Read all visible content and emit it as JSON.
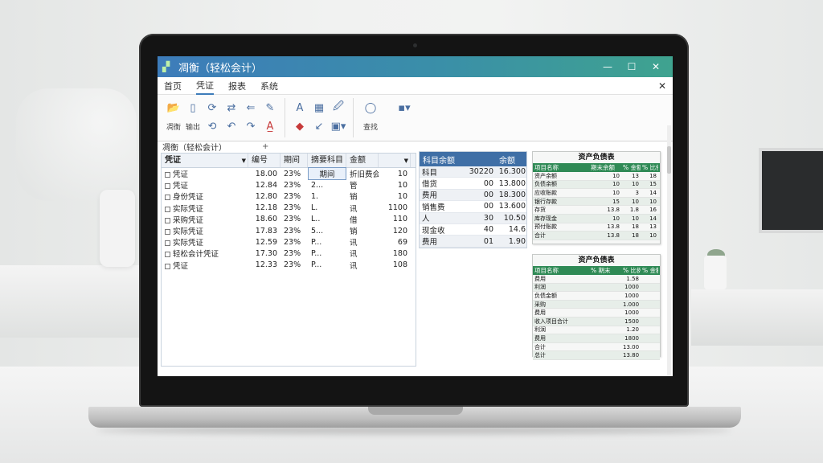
{
  "window": {
    "title": "凋衡（轻松会计）",
    "minimize": "—",
    "maximize": "☐",
    "close": "✕"
  },
  "menu": {
    "items": [
      "首页",
      "凭证",
      "报表",
      "系统"
    ],
    "close": "✕"
  },
  "ribbon": {
    "labels": [
      "凋衡",
      "输出",
      "查找"
    ]
  },
  "sheet": {
    "name": "凋衡（轻松会计）",
    "plus": "+"
  },
  "voucher_table": {
    "headers": [
      "凭证",
      "编号",
      "期间",
      "摘要科目",
      "金额",
      ""
    ],
    "rows": [
      {
        "name": "凭证",
        "date": "18.00",
        "code": "23%",
        "mid": "期间",
        "subj": "折旧费会计",
        "amt": "10"
      },
      {
        "name": "凭证",
        "date": "12.84",
        "code": "23%",
        "mid": "2...",
        "subj": "管",
        "amt": "10"
      },
      {
        "name": "身份凭证",
        "date": "12.80",
        "code": "23%",
        "mid": "1.",
        "subj": "销",
        "amt": "10"
      },
      {
        "name": "实际凭证",
        "date": "12.18",
        "code": "23%",
        "mid": "L.",
        "subj": "讯",
        "amt": "1100"
      },
      {
        "name": "采购凭证",
        "date": "18.60",
        "code": "23%",
        "mid": "L..",
        "subj": "借",
        "amt": "110"
      },
      {
        "name": "实际凭证",
        "date": "17.83",
        "code": "23%",
        "mid": "5...",
        "subj": "销",
        "amt": "120"
      },
      {
        "name": "实际凭证",
        "date": "12.59",
        "code": "23%",
        "mid": "P...",
        "subj": "讯",
        "amt": "69"
      },
      {
        "name": "轻松会计凭证",
        "date": "17.30",
        "code": "23%",
        "mid": "P...",
        "subj": "讯",
        "amt": "180"
      },
      {
        "name": "凭证",
        "date": "12.33",
        "code": "23%",
        "mid": "P...",
        "subj": "讯",
        "amt": "108"
      }
    ]
  },
  "account_table": {
    "headers": [
      "科目余额",
      "余额"
    ],
    "rows": [
      {
        "a": "科目",
        "b": "30220",
        "c": "16.300"
      },
      {
        "a": "借货",
        "b": "00",
        "c": "13.800"
      },
      {
        "a": "费用",
        "b": "00",
        "c": "18.300"
      },
      {
        "a": "销售费",
        "b": "00",
        "c": "13.600"
      },
      {
        "a": "人",
        "b": "30",
        "c": "10.50"
      },
      {
        "a": "现金收",
        "b": "40",
        "c": "14.6"
      },
      {
        "a": "费用",
        "b": "01",
        "c": "1.90"
      }
    ]
  },
  "report1": {
    "title": "资产负债表",
    "headers": [
      "项目名称",
      "期末余额",
      "% 金额",
      "% 比例"
    ],
    "rows": [
      {
        "a": "资产余额",
        "b": "10",
        "c": "13",
        "d": "18"
      },
      {
        "a": "负债余额",
        "b": "10",
        "c": "10",
        "d": "15"
      },
      {
        "a": "应收账款",
        "b": "10",
        "c": "3",
        "d": "14"
      },
      {
        "a": "银行存款",
        "b": "15",
        "c": "10",
        "d": "10"
      },
      {
        "a": "存货",
        "b": "13.8",
        "c": "1.8",
        "d": "16"
      },
      {
        "a": "库存现金",
        "b": "10",
        "c": "10",
        "d": "14"
      },
      {
        "a": "预付账款",
        "b": "13.8",
        "c": "18",
        "d": "13"
      },
      {
        "a": "合计",
        "b": "13.8",
        "c": "18",
        "d": "10"
      }
    ]
  },
  "report2": {
    "title": "资产负债表",
    "headers": [
      "项目名称",
      "% 期末",
      "% 比例",
      "% 金额"
    ],
    "rows": [
      {
        "a": "费用",
        "b": "",
        "c": "1.58",
        "d": ""
      },
      {
        "a": "利润",
        "b": "",
        "c": "1000",
        "d": ""
      },
      {
        "a": "负债金额",
        "b": "",
        "c": "1000",
        "d": ""
      },
      {
        "a": "采购",
        "b": "",
        "c": "1.000",
        "d": ""
      },
      {
        "a": "费用",
        "b": "",
        "c": "1000",
        "d": ""
      },
      {
        "a": "收入项目合计",
        "b": "",
        "c": "1500",
        "d": ""
      },
      {
        "a": "利润",
        "b": "",
        "c": "1.20",
        "d": ""
      },
      {
        "a": "费用",
        "b": "",
        "c": "1800",
        "d": ""
      },
      {
        "a": "合计",
        "b": "",
        "c": "13.00",
        "d": ""
      },
      {
        "a": "总计",
        "b": "",
        "c": "13.80",
        "d": ""
      }
    ]
  },
  "colors": {
    "title_bar_start": "#3d7cba",
    "title_bar_end": "#3fa38f",
    "report_header": "#2f8a55",
    "table_header": "#3f6fa6"
  }
}
